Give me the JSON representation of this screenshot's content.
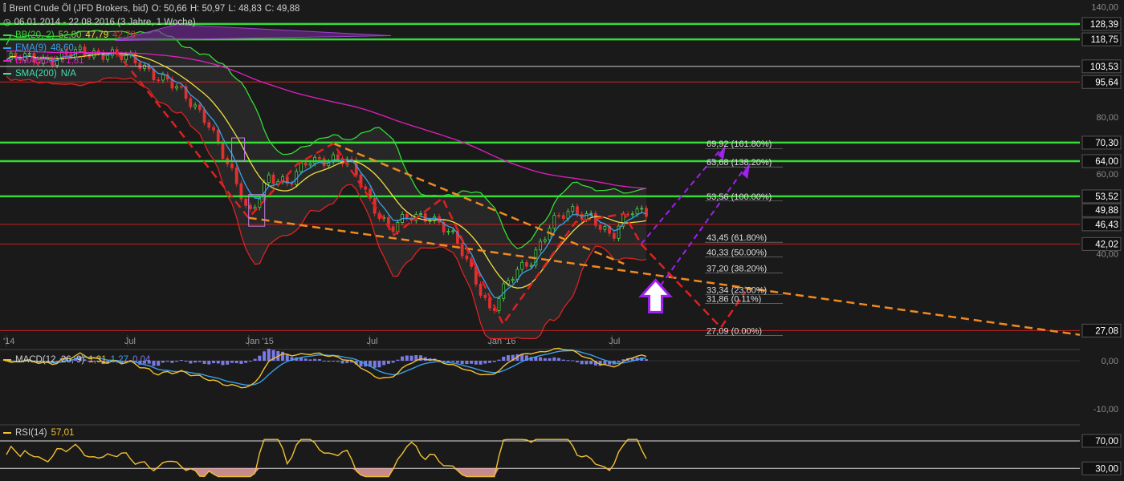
{
  "header": {
    "instrument": "Brent Crude Öl (JFD Brokers, bid)",
    "open": "O: 50,66",
    "high": "H: 50,97",
    "low": "L: 48,83",
    "close": "C: 49,88",
    "range": "06.01.2014 - 22.08.2016 (3 Jahre, 1 Woche)"
  },
  "legend": [
    {
      "name": "BB(20, 2)",
      "values": [
        "52,80",
        "47,79",
        "42,78"
      ],
      "value_colors": [
        "#7fd64a",
        "#f0e040",
        "#d93a2a"
      ],
      "color": "#3ddc3d"
    },
    {
      "name": "EMA(9)",
      "values": [
        "48,60"
      ],
      "value_colors": [
        "#3aa0e8"
      ],
      "color": "#3aa0e8"
    },
    {
      "name": "EMA(200)",
      "values": [
        "71,81"
      ],
      "value_colors": [
        "#e020c0"
      ],
      "color": "#e020c0"
    },
    {
      "name": "SMA(200)",
      "values": [
        "N/A"
      ],
      "value_colors": [
        "#40e0b0"
      ],
      "color": "#40e0b0"
    }
  ],
  "colors": {
    "background": "#1a1a1a",
    "bull_candle": "#4cd04c",
    "bear_candle": "#e03030",
    "bb_band": "#33dd33",
    "bb_mid": "#f2e040",
    "bb_lower": "#dd2222",
    "ema9": "#3aa0e8",
    "ema200": "#e020c0",
    "macd": "#f2c030",
    "signal": "#3aa0e8",
    "histogram": "#7a7ae8",
    "rsi": "#f2c030"
  },
  "chart_data": [
    {
      "type": "candlestick",
      "title": "Brent Crude Öl (JFD Brokers, bid)",
      "x_axis_labels": [
        "'14",
        "Jul",
        "Jan '15",
        "Jul",
        "Jan '16",
        "Jul"
      ],
      "y_axis_ticks": [
        "140,00",
        "80,00",
        "60,00",
        "40,00"
      ],
      "ylim": [
        25,
        145
      ],
      "y_scale": "log",
      "right_price_labels": [
        "128,39",
        "118,75",
        "103,53",
        "95,64",
        "70,30",
        "64,00",
        "53,52",
        "49,88",
        "46,43",
        "42,02",
        "27,08"
      ],
      "green_levels": [
        128.39,
        118.75,
        70.3,
        64.0,
        53.52
      ],
      "white_levels": [
        103.53
      ],
      "red_levels": [
        95.64,
        46.43,
        42.02,
        27.08
      ],
      "fib_labels": [
        "69,92 (161.80%)",
        "63,68 (138.20%)",
        "53,56 (100.00%)",
        "43,45 (61.80%)",
        "40,33 (50.00%)",
        "37,20 (38.20%)",
        "33,34 (23.60%)",
        "31,86 (0.11%)",
        "27,09 (0.00%)"
      ],
      "fib_values": [
        69.92,
        63.68,
        53.56,
        43.45,
        40.33,
        37.2,
        33.34,
        31.86,
        27.09
      ],
      "close_path": [
        [
          "2014-01",
          107
        ],
        [
          "2014-03",
          108
        ],
        [
          "2014-06",
          112
        ],
        [
          "2014-07",
          107
        ],
        [
          "2014-08",
          102
        ],
        [
          "2014-09",
          97
        ],
        [
          "2014-10",
          86
        ],
        [
          "2014-11",
          79
        ],
        [
          "2014-12",
          62
        ],
        [
          "2015-01",
          48
        ],
        [
          "2015-02",
          60
        ],
        [
          "2015-03",
          56
        ],
        [
          "2015-04",
          65
        ],
        [
          "2015-05",
          65
        ],
        [
          "2015-06",
          63
        ],
        [
          "2015-07",
          53
        ],
        [
          "2015-08",
          45
        ],
        [
          "2015-09",
          48
        ],
        [
          "2015-10",
          49
        ],
        [
          "2015-11",
          44
        ],
        [
          "2015-12",
          37
        ],
        [
          "2016-01",
          30
        ],
        [
          "2016-02",
          35
        ],
        [
          "2016-03",
          39
        ],
        [
          "2016-04",
          47
        ],
        [
          "2016-05",
          49
        ],
        [
          "2016-06",
          49
        ],
        [
          "2016-07",
          43
        ],
        [
          "2016-08",
          50
        ]
      ],
      "series": [
        {
          "name": "BB(20, 2)",
          "values": [
            52.8,
            47.79,
            42.78
          ]
        },
        {
          "name": "EMA(9)",
          "values": [
            48.6
          ]
        },
        {
          "name": "EMA(200)",
          "values": [
            71.81
          ]
        },
        {
          "name": "SMA(200)",
          "values": [
            "N/A"
          ]
        }
      ]
    },
    {
      "type": "line",
      "title": "MACD(12, 26, 9)",
      "values": [
        1.31,
        1.27,
        0.04
      ],
      "y_axis_ticks": [
        "0,00",
        "-10,00"
      ],
      "ylim": [
        -13,
        2
      ]
    },
    {
      "type": "line",
      "title": "RSI(14)",
      "values": [
        57.01
      ],
      "y_axis_ticks": [
        "70,00",
        "30,00"
      ],
      "ylim": [
        0,
        100
      ]
    }
  ],
  "macd_legend": {
    "name": "MACD(12, 26, 9)",
    "values": [
      "1,31",
      "1,27",
      "0,04"
    ]
  },
  "rsi_legend": {
    "name": "RSI(14)",
    "value": "57,01"
  }
}
